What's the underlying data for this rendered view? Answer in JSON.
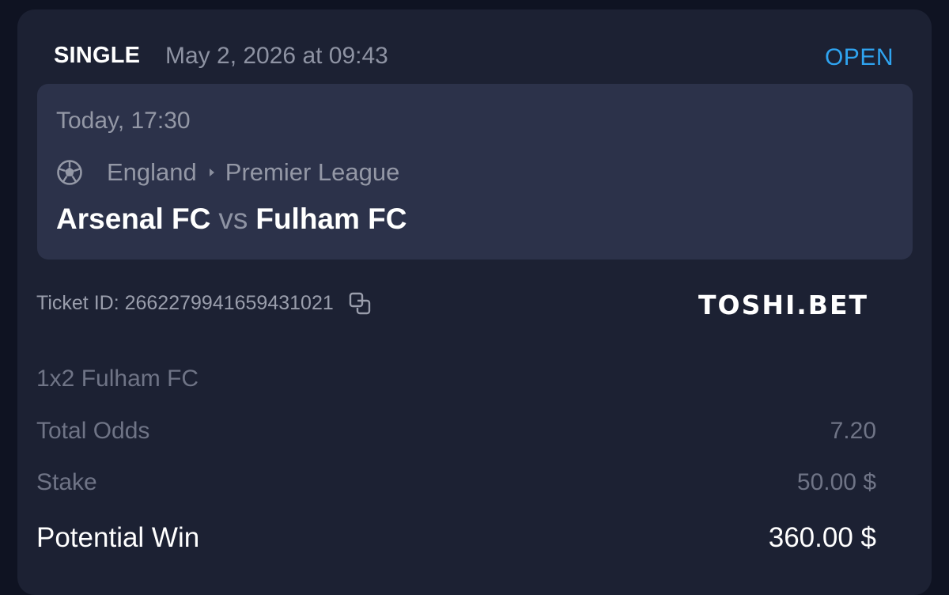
{
  "bet": {
    "type": "SINGLE",
    "placed_at": "May 2, 2026 at 09:43",
    "status": "OPEN",
    "status_color": "#2fa4f0"
  },
  "event": {
    "time": "Today, 17:30",
    "sport_icon": "soccer-ball-icon",
    "country": "England",
    "league": "Premier League",
    "home_team": "Arsenal FC",
    "vs_label": "vs",
    "away_team": "Fulham FC"
  },
  "ticket": {
    "id_text": "Ticket ID: 2662279941659431021",
    "copy_icon": "copy-icon",
    "brand": "TOSHI.BET"
  },
  "selection": "1x2 Fulham FC",
  "summary": {
    "odds_label": "Total Odds",
    "odds_value": "7.20",
    "stake_label": "Stake",
    "stake_value": "50.00 $",
    "win_label": "Potential Win",
    "win_value": "360.00 $"
  }
}
